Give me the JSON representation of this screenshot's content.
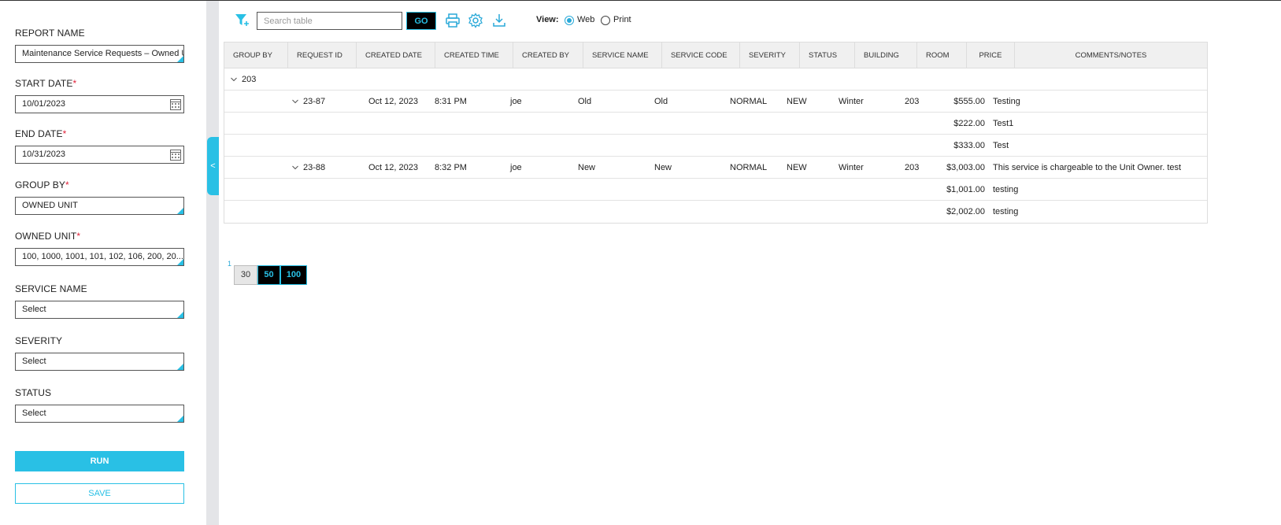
{
  "sidebar": {
    "report_name": {
      "label": "REPORT NAME",
      "value": "Maintenance Service Requests – Owned Unit"
    },
    "start_date": {
      "label": "START DATE",
      "required": "*",
      "value": "10/01/2023"
    },
    "end_date": {
      "label": "END DATE",
      "required": "*",
      "value": "10/31/2023"
    },
    "group_by": {
      "label": "GROUP BY",
      "required": "*",
      "value": "OWNED UNIT"
    },
    "owned_unit": {
      "label": "OWNED UNIT",
      "required": "*",
      "value": "100, 1000, 1001, 101, 102, 106, 200, 20..."
    },
    "service_name": {
      "label": "SERVICE NAME",
      "value": "Select"
    },
    "severity": {
      "label": "SEVERITY",
      "value": "Select"
    },
    "status": {
      "label": "STATUS",
      "value": "Select"
    },
    "run_label": "RUN",
    "save_label": "SAVE",
    "collapse_glyph": "<"
  },
  "toolbar": {
    "search_placeholder": "Search table",
    "go_label": "GO",
    "view_label": "View:",
    "view_options": [
      "Web",
      "Print"
    ],
    "view_selected": "Web"
  },
  "table": {
    "headers": [
      "GROUP BY",
      "REQUEST ID",
      "CREATED DATE",
      "CREATED TIME",
      "CREATED BY",
      "SERVICE NAME",
      "SERVICE CODE",
      "SEVERITY",
      "STATUS",
      "BUILDING",
      "ROOM",
      "PRICE",
      "COMMENTS/NOTES"
    ],
    "group": "203",
    "requests": [
      {
        "id": "23-87",
        "created_date": "Oct 12, 2023",
        "created_time": "8:31 PM",
        "created_by": "joe",
        "service_name": "Old",
        "service_code": "Old",
        "severity": "NORMAL",
        "status": "NEW",
        "building": "Winter",
        "room": "203",
        "price": "$555.00",
        "comments": "Testing",
        "subitems": [
          {
            "price": "$222.00",
            "comments": "Test1"
          },
          {
            "price": "$333.00",
            "comments": "Test"
          }
        ]
      },
      {
        "id": "23-88",
        "created_date": "Oct 12, 2023",
        "created_time": "8:32 PM",
        "created_by": "joe",
        "service_name": "New",
        "service_code": "New",
        "severity": "NORMAL",
        "status": "NEW",
        "building": "Winter",
        "room": "203",
        "price": "$3,003.00",
        "comments": "This service is chargeable to the Unit Owner. test",
        "subitems": [
          {
            "price": "$1,001.00",
            "comments": "testing"
          },
          {
            "price": "$2,002.00",
            "comments": "testing"
          }
        ]
      }
    ]
  },
  "pagination": {
    "page": "1",
    "sizes": [
      "30",
      "50",
      "100"
    ],
    "selected_size": "30"
  },
  "colors": {
    "accent": "#29c0e5",
    "required": "#e0223a"
  }
}
